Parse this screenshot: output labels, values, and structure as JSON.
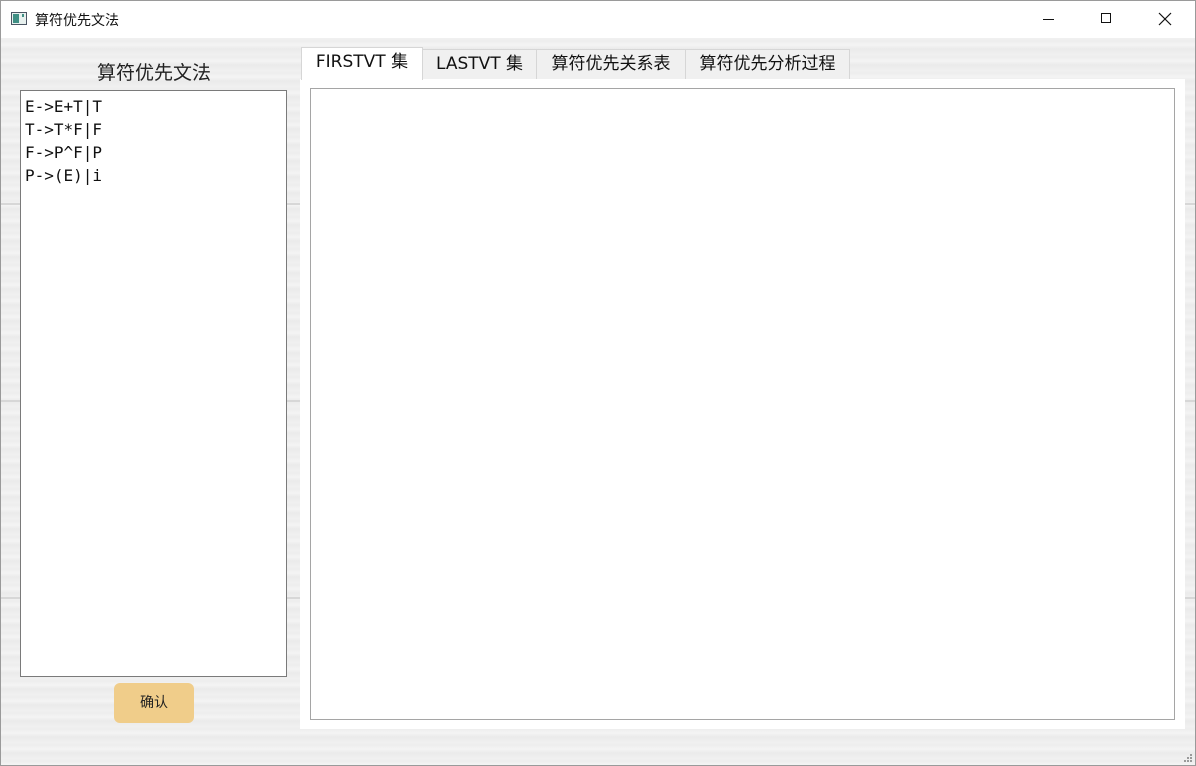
{
  "window": {
    "title": "算符优先文法"
  },
  "left_panel": {
    "heading": "算符优先文法",
    "grammar_lines": [
      "E->E+T|T",
      "T->T*F|F",
      "F->P^F|P",
      "P->(E)|i"
    ],
    "confirm_label": "确认",
    "confirm_color": "#f0cd8a"
  },
  "tabs": [
    {
      "label": "FIRSTVT 集",
      "active": true
    },
    {
      "label": "LASTVT 集",
      "active": false
    },
    {
      "label": "算符优先关系表",
      "active": false
    },
    {
      "label": "算符优先分析过程",
      "active": false
    }
  ],
  "icons": {
    "app": "app-icon",
    "minimize": "minimize-icon",
    "maximize": "maximize-icon",
    "close": "close-icon"
  }
}
